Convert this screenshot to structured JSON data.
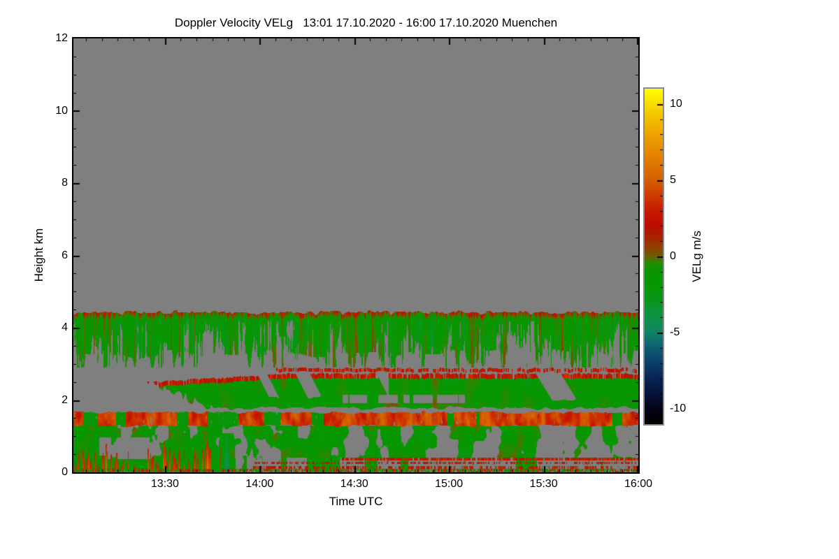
{
  "title": "Doppler Velocity VELg   13:01 17.10.2020 - 16:00 17.10.2020 Muenchen",
  "axes": {
    "x": {
      "label": "Time UTC",
      "start": "13:01",
      "end": "16:00",
      "span_minutes": 179,
      "minor_every_clock_minutes": 5,
      "ticks": [
        {
          "label": "13:30",
          "minute": 29
        },
        {
          "label": "14:00",
          "minute": 59
        },
        {
          "label": "14:30",
          "minute": 89
        },
        {
          "label": "15:00",
          "minute": 119
        },
        {
          "label": "15:30",
          "minute": 149
        },
        {
          "label": "16:00",
          "minute": 179
        }
      ]
    },
    "y": {
      "label": "Height km",
      "min": 0,
      "max": 12,
      "minor_step": 0.5,
      "ticks": [
        {
          "label": "0",
          "value": 0
        },
        {
          "label": "2",
          "value": 2
        },
        {
          "label": "4",
          "value": 4
        },
        {
          "label": "6",
          "value": 6
        },
        {
          "label": "8",
          "value": 8
        },
        {
          "label": "10",
          "value": 10
        },
        {
          "label": "12",
          "value": 12
        }
      ]
    }
  },
  "colorbar": {
    "label": "VELg m/s",
    "vmin": -11,
    "vmax": 11,
    "minor_step": 1,
    "ticks": [
      {
        "label": "10",
        "value": 10
      },
      {
        "label": "5",
        "value": 5
      },
      {
        "label": "0",
        "value": 0
      },
      {
        "label": "-5",
        "value": -5
      },
      {
        "label": "-10",
        "value": -10
      }
    ],
    "stops": [
      [
        -11,
        "#000000"
      ],
      [
        -10,
        "#02041a"
      ],
      [
        -9,
        "#051338"
      ],
      [
        -8,
        "#082457"
      ],
      [
        -7,
        "#0b3f69"
      ],
      [
        -6,
        "#0e5d73"
      ],
      [
        -5,
        "#108366"
      ],
      [
        -4,
        "#0e9348"
      ],
      [
        -3,
        "#0a9520"
      ],
      [
        -2,
        "#089704"
      ],
      [
        -1,
        "#079700"
      ],
      [
        -0.4,
        "#278a00"
      ],
      [
        0,
        "#6b5f00"
      ],
      [
        0.5,
        "#8d4300"
      ],
      [
        1.2,
        "#a52600"
      ],
      [
        2,
        "#bc0d00"
      ],
      [
        2.8,
        "#c51500"
      ],
      [
        3.6,
        "#cb2d00"
      ],
      [
        5,
        "#d65e00"
      ],
      [
        6.5,
        "#e28000"
      ],
      [
        8,
        "#eca300"
      ],
      [
        9.5,
        "#f6cb00"
      ],
      [
        11,
        "#ffff00"
      ]
    ]
  },
  "chart_data": {
    "type": "heatmap",
    "title": "Doppler Velocity VELg   13:01 17.10.2020 - 16:00 17.10.2020 Muenchen",
    "xlabel": "Time UTC",
    "ylabel": "Height km",
    "value_label": "VELg m/s",
    "x_start_label": "13:01",
    "x_end_label": "16:00",
    "x_range_minutes": [
      0,
      179
    ],
    "ylim_km": [
      0,
      12
    ],
    "value_range_ms": [
      -11,
      11
    ],
    "no_data_color": "#7f7f7f",
    "site": "Muenchen",
    "date": "17.10.2020",
    "layers": [
      {
        "name": "upper-cloud-band",
        "description": "Cloud layer 3.0-4.5 km across full period; mostly weak negative (green) velocities with olive/orange streaks and reddish caps at cloud top; ragged fall streaks at base",
        "t_min": 0,
        "t_max": 179,
        "h_top_km": 4.42,
        "h_top_jitter_km": 0.09,
        "h_bottom_km": 3.3,
        "h_bottom_jitter_km": 0.3,
        "fallstreak_depth_km": 0.85,
        "velocity_mean_ms": -1.6,
        "velocity_amp_ms": 2.8,
        "cap_thickness_km": 0.2,
        "cap_velocity_ms": 2.2
      },
      {
        "name": "thin-streak",
        "description": "Thin broken speckle layer near 2.8 km from about 14:05 onward, weak positive velocities",
        "t_min": 64,
        "t_max": 179,
        "h_km": 2.82,
        "thickness_km": 0.05,
        "velocity_mean_ms": 2.2,
        "velocity_amp_ms": 1.8
      },
      {
        "name": "mid-band",
        "description": "Layer 1.8-2.7 km starting ~13:25 with rising orange-speckled top edge, green body, diagonal clear fall-streak gaps",
        "t_min": 23,
        "t_max": 179,
        "h_bottom_km": 1.77,
        "h_top_start_km": 2.48,
        "h_top_end_km": 2.72,
        "top_ramp_minutes": 45,
        "velocity_mean_ms": -1.3,
        "velocity_amp_ms": 1.7,
        "cap_thickness_km": 0.13,
        "cap_velocity_ms": 2.2
      },
      {
        "name": "orange-band",
        "description": "Continuous band 1.3-1.65 km across full period dominated by positive (orange/red) velocities with occasional green patches",
        "t_min": 0,
        "t_max": 179,
        "h_bottom_km": 1.28,
        "h_top_km": 1.65,
        "velocity_mean_ms": 3.6,
        "velocity_amp_ms": 2.2,
        "green_patch_velocity_ms": -1.4
      },
      {
        "name": "boundary-layer",
        "description": "Patchy boundary layer below 1.3 km: green updraft patches, red ground-based streaks before ~13:50, teal downdraft plume near 13:50, dashed red speckle rows near the surface after ~14:00",
        "t_min": 0,
        "t_max": 179,
        "h_top_km": 1.28,
        "velocity_mean_ms": -1.6,
        "velocity_amp_ms": 1.8,
        "red_streak_t_max": 48,
        "red_streak_velocity_ms": 3.0,
        "plume_t_minutes": 48.5,
        "plume_halfwidth_minutes": 2.3,
        "plume_top_km": 1.08,
        "plume_velocity_ms": -5.2,
        "speckle_rows": [
          {
            "h_km": 0.36,
            "t_min": 85,
            "density": 0.8
          },
          {
            "h_km": 0.25,
            "t_min": 57,
            "density": 0.55
          },
          {
            "h_km": 0.13,
            "t_min": 57,
            "density": 0.5
          }
        ],
        "ground_layer_km": 0.09,
        "clear_patch": {
          "t_min": 8,
          "t_max": 24,
          "h_min_km": 0.35,
          "h_max_km": 0.95
        }
      }
    ]
  }
}
